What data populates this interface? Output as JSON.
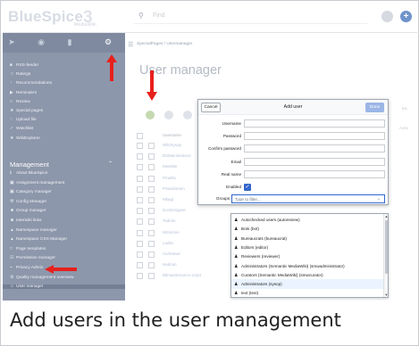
{
  "header": {
    "logo_text": "BlueSpice",
    "logo_sub": "MediaWiki",
    "logo_mark": "3",
    "search_placeholder": "Find",
    "add_button_label": "+"
  },
  "sidebar": {
    "tab_icons": [
      "paper-plane-icon",
      "globe-icon",
      "document-icon",
      "gear-icon"
    ],
    "items": [
      {
        "icon": "■",
        "label": "RSS-feeder"
      },
      {
        "icon": "☆",
        "label": "Ratings"
      },
      {
        "icon": "↑",
        "label": "Recommendations"
      },
      {
        "icon": "▶",
        "label": "Reminders"
      },
      {
        "icon": "□",
        "label": "Review"
      },
      {
        "icon": "★",
        "label": "Special pages"
      },
      {
        "icon": "↑",
        "label": "Upload file"
      },
      {
        "icon": "✓",
        "label": "Watchlist"
      },
      {
        "icon": "★",
        "label": "WikiExplorer"
      }
    ],
    "management_heading": "Management",
    "management_items": [
      {
        "icon": "ℹ",
        "label": "About BlueSpice"
      },
      {
        "icon": "▣",
        "label": "Assignment management"
      },
      {
        "icon": "▣",
        "label": "Category manager"
      },
      {
        "icon": "⚒",
        "label": "Config Manager"
      },
      {
        "icon": "☻",
        "label": "Group manager"
      },
      {
        "icon": "☻",
        "label": "Interwiki links"
      },
      {
        "icon": "▲",
        "label": "Namespace manager"
      },
      {
        "icon": "▲",
        "label": "Namespace CSS Manager"
      },
      {
        "icon": "□",
        "label": "Page templates"
      },
      {
        "icon": "☑",
        "label": "Permission manager"
      },
      {
        "icon": "⌁",
        "label": "Privacy Admin"
      },
      {
        "icon": "⚙",
        "label": "Quality management overview"
      },
      {
        "icon": "☺",
        "label": "User manager"
      }
    ]
  },
  "main": {
    "breadcrumb": "SpecialPages / Usermanager",
    "title": "User manager",
    "column_header": "Username",
    "right_col_1": "Ea",
    "right_col_2": "Activ",
    "users": [
      "WikiSysop",
      "BSMaintenance",
      "Mweible",
      "Pmeilla",
      "PSandmann",
      "Mkagi",
      "DocDesigner",
      "Tadmin",
      "MSimmie",
      "Ladbo",
      "Civilviews",
      "Nadmin",
      "Bltmaintenance script"
    ]
  },
  "dialog": {
    "cancel_label": "Cancel",
    "title": "Add user",
    "done_label": "Done",
    "fields": [
      {
        "label": "Username",
        "value": ""
      },
      {
        "label": "Password",
        "value": ""
      },
      {
        "label": "Confirm password",
        "value": ""
      },
      {
        "label": "Email",
        "value": ""
      },
      {
        "label": "Real name",
        "value": ""
      }
    ],
    "enabled_label": "Enabled",
    "enabled_checked": true,
    "groups_label": "Groups",
    "groups_placeholder": "Type to filter..."
  },
  "dropdown": {
    "options": [
      {
        "label": "Autochecked users (autoreview)",
        "selected": false
      },
      {
        "label": "Bots (bot)",
        "selected": false
      },
      {
        "label": "Bureaucrats (bureaucrat)",
        "selected": false
      },
      {
        "label": "Editors (editor)",
        "selected": false
      },
      {
        "label": "Reviewers (reviewer)",
        "selected": false
      },
      {
        "label": "Administrators (Semantic MediaWiki) (smwadministrator)",
        "selected": false
      },
      {
        "label": "Curators (Semantic MediaWiki) (smwcurator)",
        "selected": false
      },
      {
        "label": "Administrators (sysop)",
        "selected": true
      },
      {
        "label": "text (text)",
        "selected": false
      }
    ]
  },
  "caption": "Add users in the user management",
  "colors": {
    "sidebar_bg": "#8d97ab",
    "annotation_arrow": "#e8201c",
    "primary_blue": "#3366cc"
  }
}
